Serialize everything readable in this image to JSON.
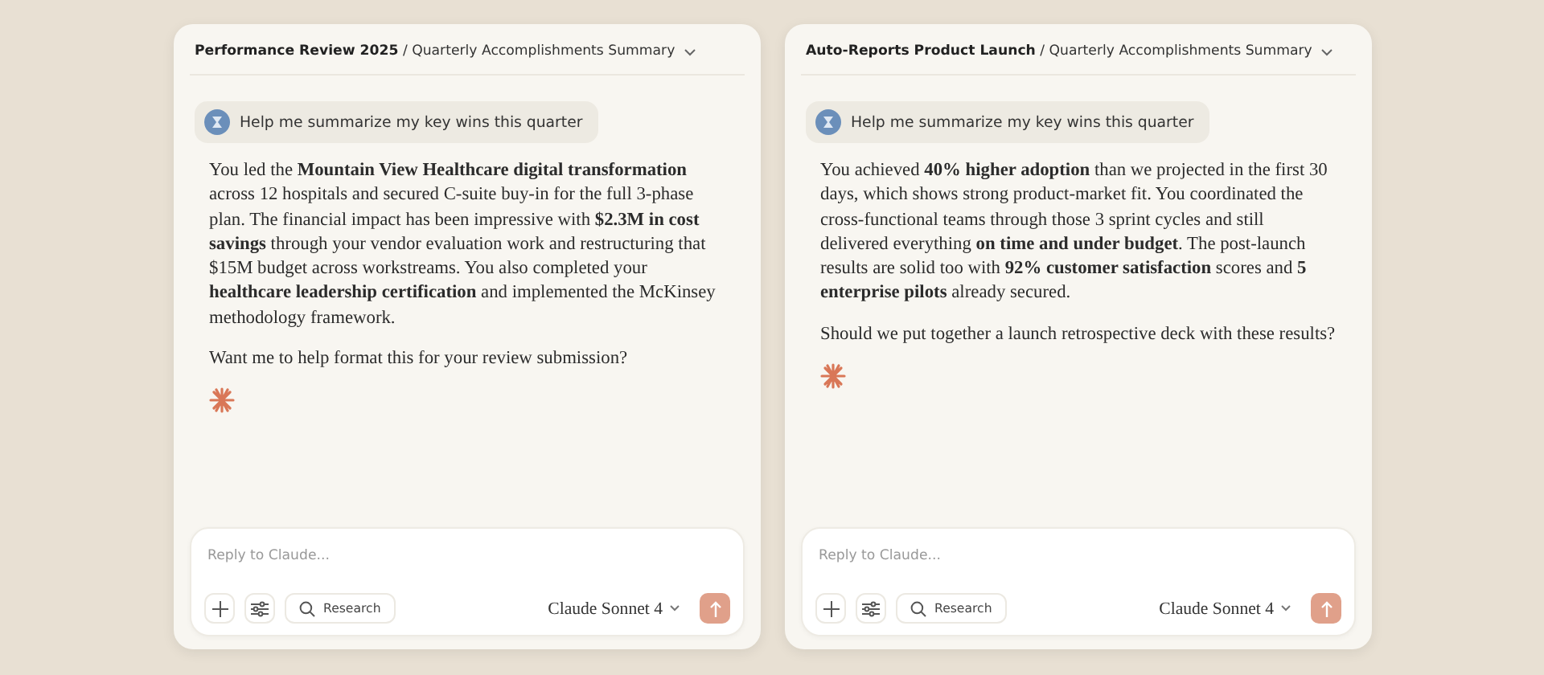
{
  "chats": [
    {
      "title": "**Performance Review 2025** / Quarterly Accomplishments Summary",
      "prompt": "Help me summarize my key wins this quarter",
      "response": [
        "You led the **Mountain View Healthcare digital transformation** across 12 hospitals and secured C-suite buy-in for the full 3-phase plan. The financial impact has been impressive with **$2.3M in cost savings** through your vendor evaluation work and restructuring that $15M budget across workstreams. You also completed your **healthcare leadership certification** and implemented the McKinsey methodology framework.",
        "Want me to help format this for your review submission?"
      ],
      "reply": {
        "placeholder": "Reply to Claude...",
        "tool": "Research",
        "model": "Claude Sonnet 4"
      }
    },
    {
      "title": "**Auto-Reports Product Launch** / Quarterly Accomplishments Summary",
      "prompt": "Help me summarize my key wins this quarter",
      "response": [
        "You achieved **40% higher adoption** than we projected in the first 30 days, which shows strong product-market fit. You coordinated the cross-functional teams through those 3 sprint cycles and still delivered everything **on time and under budget**. The post-launch results are solid too with **92% customer satisfaction** scores and **5 enterprise pilots** already secured.",
        "Should we put together a launch retrospective deck with these results?"
      ],
      "reply": {
        "placeholder": "Reply to Claude...",
        "tool": "Research",
        "model": "Claude Sonnet 4"
      }
    }
  ]
}
